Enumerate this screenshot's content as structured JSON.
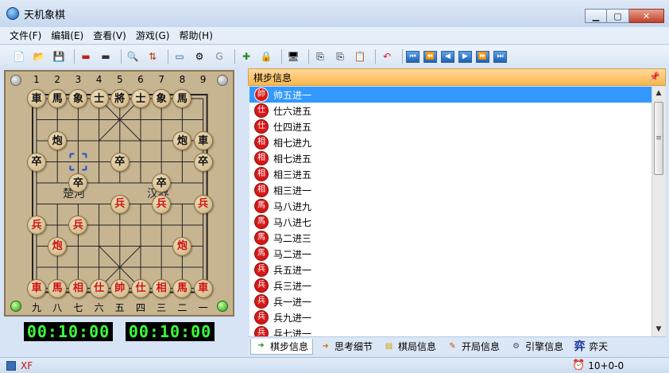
{
  "window": {
    "title": "天机象棋"
  },
  "menu": [
    "文件(F)",
    "编辑(E)",
    "查看(V)",
    "游戏(G)",
    "帮助(H)"
  ],
  "board": {
    "files_top": [
      "1",
      "2",
      "3",
      "4",
      "5",
      "6",
      "7",
      "8",
      "9"
    ],
    "files_bottom": [
      "九",
      "八",
      "七",
      "六",
      "五",
      "四",
      "三",
      "二",
      "一"
    ],
    "river_left": "楚河",
    "river_right": "汉界",
    "pieces": [
      {
        "char": "車",
        "side": "black",
        "col": 0,
        "row": 0
      },
      {
        "char": "馬",
        "side": "black",
        "col": 1,
        "row": 0
      },
      {
        "char": "象",
        "side": "black",
        "col": 2,
        "row": 0
      },
      {
        "char": "士",
        "side": "black",
        "col": 3,
        "row": 0
      },
      {
        "char": "將",
        "side": "black",
        "col": 4,
        "row": 0
      },
      {
        "char": "士",
        "side": "black",
        "col": 5,
        "row": 0
      },
      {
        "char": "象",
        "side": "black",
        "col": 6,
        "row": 0
      },
      {
        "char": "馬",
        "side": "black",
        "col": 7,
        "row": 0
      },
      {
        "char": "炮",
        "side": "black",
        "col": 1,
        "row": 2
      },
      {
        "char": "炮",
        "side": "black",
        "col": 7,
        "row": 2
      },
      {
        "char": "車",
        "side": "black",
        "col": 8,
        "row": 2
      },
      {
        "char": "卒",
        "side": "black",
        "col": 0,
        "row": 3
      },
      {
        "char": "卒",
        "side": "black",
        "col": 4,
        "row": 3
      },
      {
        "char": "卒",
        "side": "black",
        "col": 8,
        "row": 3
      },
      {
        "char": "卒",
        "side": "black",
        "col": 2,
        "row": 4
      },
      {
        "char": "卒",
        "side": "black",
        "col": 6,
        "row": 4
      },
      {
        "char": "兵",
        "side": "red",
        "col": 4,
        "row": 5
      },
      {
        "char": "兵",
        "side": "red",
        "col": 6,
        "row": 5
      },
      {
        "char": "兵",
        "side": "red",
        "col": 8,
        "row": 5
      },
      {
        "char": "兵",
        "side": "red",
        "col": 0,
        "row": 6
      },
      {
        "char": "兵",
        "side": "red",
        "col": 2,
        "row": 6
      },
      {
        "char": "炮",
        "side": "red",
        "col": 1,
        "row": 7
      },
      {
        "char": "炮",
        "side": "red",
        "col": 7,
        "row": 7
      },
      {
        "char": "車",
        "side": "red",
        "col": 0,
        "row": 9
      },
      {
        "char": "馬",
        "side": "red",
        "col": 1,
        "row": 9
      },
      {
        "char": "相",
        "side": "red",
        "col": 2,
        "row": 9
      },
      {
        "char": "仕",
        "side": "red",
        "col": 3,
        "row": 9
      },
      {
        "char": "帥",
        "side": "red",
        "col": 4,
        "row": 9
      },
      {
        "char": "仕",
        "side": "red",
        "col": 5,
        "row": 9
      },
      {
        "char": "相",
        "side": "red",
        "col": 6,
        "row": 9
      },
      {
        "char": "馬",
        "side": "red",
        "col": 7,
        "row": 9
      },
      {
        "char": "車",
        "side": "red",
        "col": 8,
        "row": 9
      }
    ]
  },
  "clocks": {
    "left": "00:10:00",
    "right": "00:10:00"
  },
  "panel": {
    "title": "棋步信息",
    "moves": [
      {
        "badge": "帥",
        "text": "帅五进一",
        "selected": true
      },
      {
        "badge": "仕",
        "text": "仕六进五",
        "selected": false
      },
      {
        "badge": "仕",
        "text": "仕四进五",
        "selected": false
      },
      {
        "badge": "相",
        "text": "相七进九",
        "selected": false
      },
      {
        "badge": "相",
        "text": "相七进五",
        "selected": false
      },
      {
        "badge": "相",
        "text": "相三进五",
        "selected": false
      },
      {
        "badge": "相",
        "text": "相三进一",
        "selected": false
      },
      {
        "badge": "馬",
        "text": "马八进九",
        "selected": false
      },
      {
        "badge": "馬",
        "text": "马八进七",
        "selected": false
      },
      {
        "badge": "馬",
        "text": "马二进三",
        "selected": false
      },
      {
        "badge": "馬",
        "text": "马二进一",
        "selected": false
      },
      {
        "badge": "兵",
        "text": "兵五进一",
        "selected": false
      },
      {
        "badge": "兵",
        "text": "兵三进一",
        "selected": false
      },
      {
        "badge": "兵",
        "text": "兵一进一",
        "selected": false
      },
      {
        "badge": "兵",
        "text": "兵九进一",
        "selected": false
      },
      {
        "badge": "兵",
        "text": "兵七进一",
        "selected": false
      }
    ]
  },
  "tabs": [
    {
      "label": "棋步信息",
      "icon": "arrow-doc-icon",
      "active": true
    },
    {
      "label": "思考细节",
      "icon": "think-doc-icon",
      "active": false
    },
    {
      "label": "棋局信息",
      "icon": "notepad-icon",
      "active": false
    },
    {
      "label": "开局信息",
      "icon": "pencil-icon",
      "active": false
    },
    {
      "label": "引擎信息",
      "icon": "engine-icon",
      "active": false
    },
    {
      "label": "弈天",
      "icon": "yitian-logo-icon",
      "active": false
    }
  ],
  "status": {
    "left": "XF",
    "right": "10+0-0"
  }
}
